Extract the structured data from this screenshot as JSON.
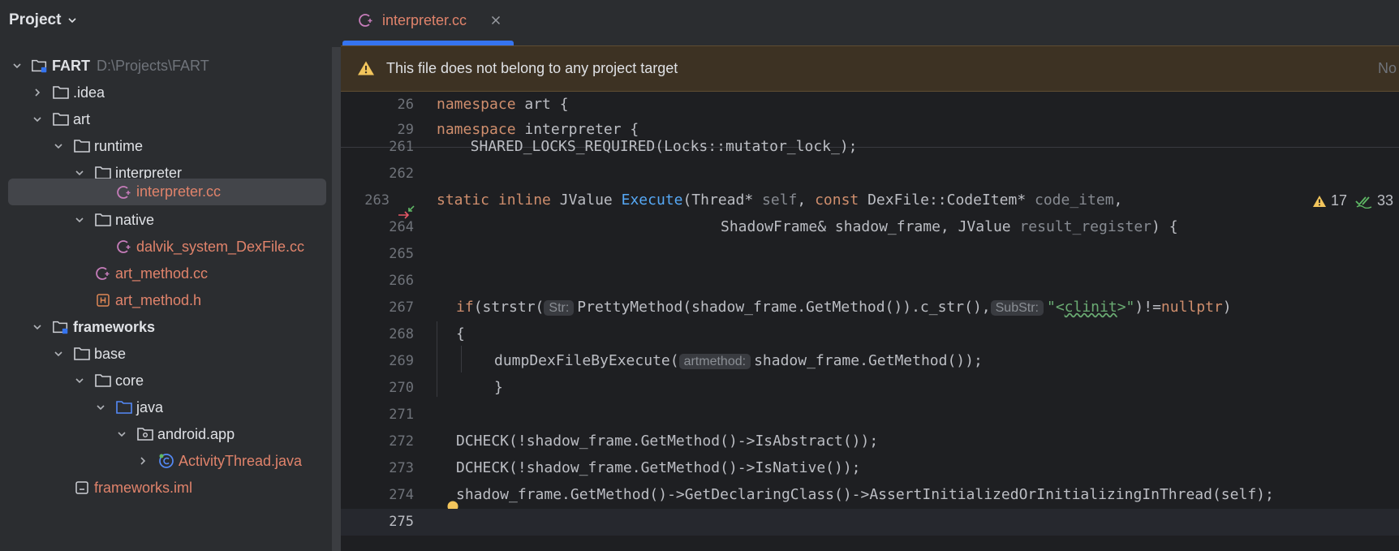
{
  "project_panel": {
    "title": "Project",
    "tree": [
      {
        "label": "FART",
        "path": "D:\\Projects\\FART",
        "bold": true
      },
      {
        "label": ".idea"
      },
      {
        "label": "art"
      },
      {
        "label": "runtime"
      },
      {
        "label": "interpreter"
      },
      {
        "label": "interpreter.cc"
      },
      {
        "label": "native"
      },
      {
        "label": "dalvik_system_DexFile.cc"
      },
      {
        "label": "art_method.cc"
      },
      {
        "label": "art_method.h"
      },
      {
        "label": "frameworks",
        "bold": true
      },
      {
        "label": "base"
      },
      {
        "label": "core"
      },
      {
        "label": "java"
      },
      {
        "label": "android.app"
      },
      {
        "label": "ActivityThread.java"
      },
      {
        "label": "frameworks.iml"
      }
    ]
  },
  "editor": {
    "tab": {
      "label": "interpreter.cc"
    },
    "banner": {
      "message": "This file does not belong to any project target",
      "action": "No"
    },
    "inspections": {
      "warnings": "17",
      "weak_warnings": "33"
    },
    "sticky": [
      {
        "ln": "26",
        "kw": "namespace",
        "rest": " art {"
      },
      {
        "ln": "29",
        "kw": "namespace",
        "rest": " interpreter {"
      }
    ],
    "lines": {
      "l261": {
        "ln": "261",
        "text": "  SHARED_LOCKS_REQUIRED(Locks::mutator_lock_);"
      },
      "l262": {
        "ln": "262"
      },
      "l263": {
        "ln": "263",
        "kw1": "static",
        "kw2": "inline",
        "t1": " JValue ",
        "fn": "Execute",
        "t2": "(Thread* ",
        "p1": "self",
        "t3": ", ",
        "kw3": "const",
        "t4": " DexFile::CodeItem* ",
        "p2": "code_item",
        "t5": ","
      },
      "l264": {
        "ln": "264",
        "t1": "ShadowFrame& shadow_frame, JValue ",
        "p1": "result_register",
        "t2": ") {"
      },
      "l265": {
        "ln": "265"
      },
      "l266": {
        "ln": "266"
      },
      "l267": {
        "ln": "267",
        "kw1": "if",
        "t1": "(strstr(",
        "h1": "Str:",
        "t2": "PrettyMethod(shadow_frame.GetMethod()).c_str(),",
        "h2": "SubStr:",
        "s1": "\"<",
        "s2": "clinit",
        "s3": ">\"",
        "t3": ")!=",
        "kw2": "nullptr",
        "t4": ")"
      },
      "l268": {
        "ln": "268",
        "text": "{"
      },
      "l269": {
        "ln": "269",
        "t1": "dumpDexFileByExecute(",
        "h1": "artmethod:",
        "t2": "shadow_frame.GetMethod());"
      },
      "l270": {
        "ln": "270",
        "text": "}"
      },
      "l271": {
        "ln": "271"
      },
      "l272": {
        "ln": "272",
        "text": "DCHECK(!shadow_frame.GetMethod()->IsAbstract());"
      },
      "l273": {
        "ln": "273",
        "text": "DCHECK(!shadow_frame.GetMethod()->IsNative());"
      },
      "l274": {
        "ln": "274",
        "text": "shadow_frame.GetMethod()->GetDeclaringClass()->AssertInitializedOrInitializingInThread(self);"
      },
      "l275": {
        "ln": "275"
      }
    }
  },
  "colors": {
    "accent": "#3574f0",
    "keyword": "#cf8e6d",
    "function": "#56a8f5",
    "string": "#6aab73",
    "file_cpp": "#e0836b",
    "banner_bg": "#3d3223"
  }
}
